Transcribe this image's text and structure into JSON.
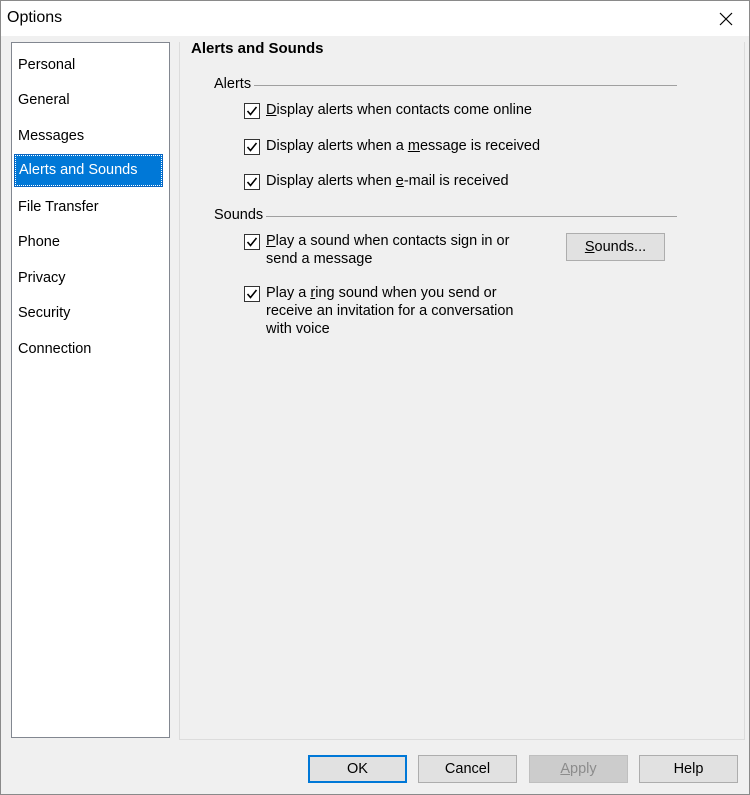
{
  "window": {
    "title": "Options"
  },
  "sidebar": {
    "items": [
      {
        "label": "Personal"
      },
      {
        "label": "General"
      },
      {
        "label": "Messages"
      },
      {
        "label": "Alerts and Sounds"
      },
      {
        "label": "File Transfer"
      },
      {
        "label": "Phone"
      },
      {
        "label": "Privacy"
      },
      {
        "label": "Security"
      },
      {
        "label": "Connection"
      }
    ],
    "selected": "Alerts and Sounds"
  },
  "panel": {
    "title": "Alerts and Sounds",
    "alerts_group": {
      "label": "Alerts",
      "options": [
        {
          "pre": "",
          "ul": "D",
          "post": "isplay alerts when contacts come online",
          "checked": true
        },
        {
          "pre": "Display alerts when a ",
          "ul": "m",
          "post": "essage is received",
          "checked": true
        },
        {
          "pre": "Display alerts when ",
          "ul": "e",
          "post": "-mail is received",
          "checked": true
        }
      ]
    },
    "sounds_group": {
      "label": "Sounds",
      "options": [
        {
          "pre": "",
          "ul": "P",
          "post": "lay a sound when contacts sign in or",
          "line2": "send a message",
          "checked": true
        },
        {
          "pre": "Play a ",
          "ul": "r",
          "post": "ing sound when you send or",
          "line2": "receive an invitation for a conversation",
          "line3": "with voice",
          "checked": true
        }
      ],
      "sounds_button": {
        "ul": "S",
        "post": "ounds..."
      }
    }
  },
  "footer": {
    "ok": "OK",
    "cancel": "Cancel",
    "apply_ul": "A",
    "apply_post": "pply",
    "help": "Help"
  }
}
